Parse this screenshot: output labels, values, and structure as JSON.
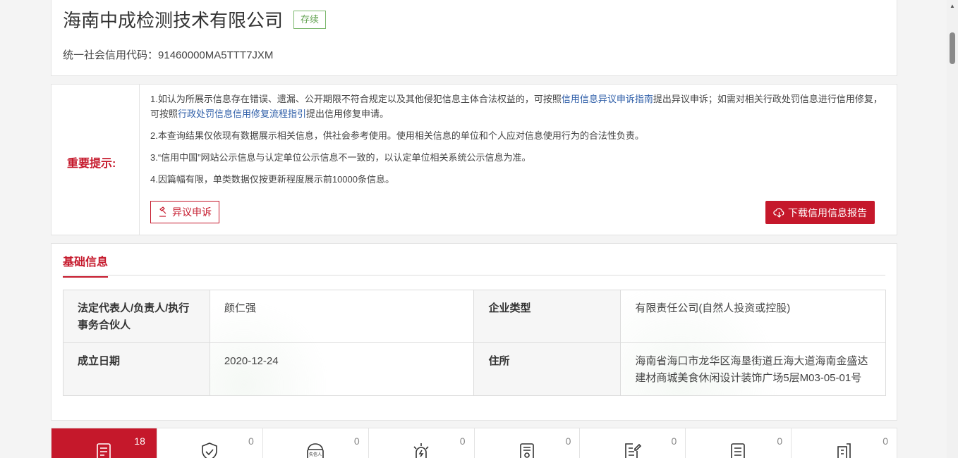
{
  "company": {
    "name": "海南中成检测技术有限公司",
    "status": "存续",
    "credit_code_label": "统一社会信用代码：",
    "credit_code": "91460000MA5TTT7JXM"
  },
  "notice": {
    "title": "重要提示:",
    "item1_prefix": "1.如认为所展示信息存在错误、遗漏、公开期限不符合规定以及其他侵犯信息主体合法权益的，可按照",
    "item1_link1": "信用信息异议申诉指南",
    "item1_middle": "提出异议申诉；如需对相关行政处罚信息进行信用修复，可按照",
    "item1_link2": "行政处罚信息信用修复流程指引",
    "item1_suffix": "提出信用修复申请。",
    "item2": "2.本查询结果仅依现有数据展示相关信息，供社会参考使用。使用相关信息的单位和个人应对信息使用行为的合法性负责。",
    "item3": "3.“信用中国”网站公示信息与认定单位公示信息不一致的，以认定单位相关系统公示信息为准。",
    "item4": "4.因篇幅有限，单类数据仅按更新程度展示前10000条信息。",
    "appeal_label": "异议申诉",
    "download_label": "下载信用信息报告"
  },
  "basic_info": {
    "tab_label": "基础信息",
    "rows": [
      {
        "label1": "法定代表人/负责人/执行事务合伙人",
        "value1": "颜仁强",
        "label2": "企业类型",
        "value2": "有限责任公司(自然人投资或控股)"
      },
      {
        "label1": "成立日期",
        "value1": "2020-12-24",
        "label2": "住所",
        "value2": "海南省海口市龙华区海垦街道丘海大道海南金盛达建材商城美食休闲设计装饰广场5层M03-05-01号"
      }
    ]
  },
  "categories": [
    {
      "count": "18",
      "icon": "document-list-icon",
      "active": true
    },
    {
      "count": "0",
      "icon": "shield-check-icon"
    },
    {
      "count": "0",
      "icon": "dishonest-badge-icon",
      "badge_text": "失信人"
    },
    {
      "count": "0",
      "icon": "warning-light-icon"
    },
    {
      "count": "0",
      "icon": "certificate-icon"
    },
    {
      "count": "0",
      "icon": "edit-document-icon"
    },
    {
      "count": "0",
      "icon": "report-document-icon"
    },
    {
      "count": "0",
      "icon": "building-icon"
    }
  ],
  "colors": {
    "accent": "#c5182b",
    "status_green": "#62a250",
    "link_blue": "#2e5ea8"
  }
}
